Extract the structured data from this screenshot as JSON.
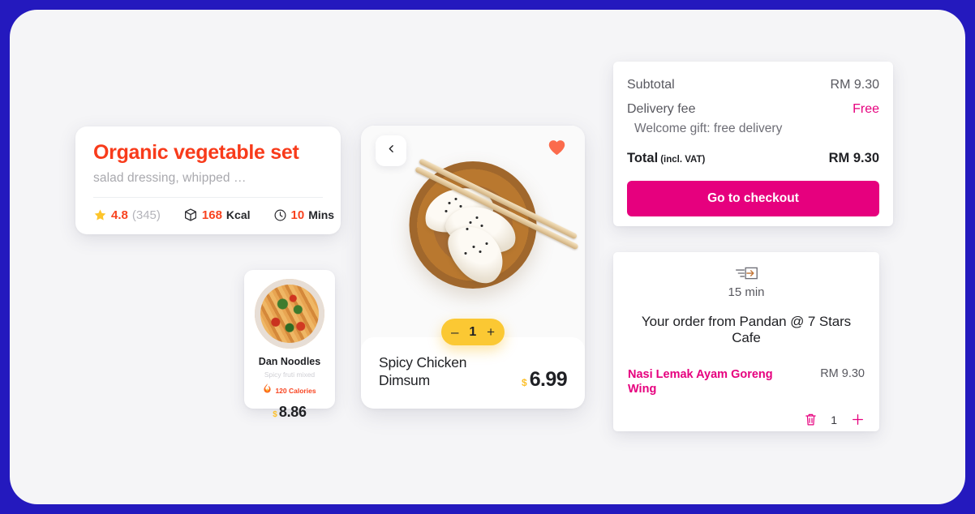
{
  "theme": {
    "frame_blue": "#2419be",
    "canvas_bg": "#f5f5f7",
    "accent_orange": "#f8431f",
    "accent_pink": "#e6007e",
    "accent_yellow": "#fbc833",
    "heart_coral": "#fb6b4c"
  },
  "organic_card": {
    "title": "Organic vegetable set",
    "subtitle": "salad dressing, whipped …",
    "stats": [
      {
        "icon": "star-icon",
        "value": "4.8",
        "suffix": "(345)",
        "unit": ""
      },
      {
        "icon": "box-icon",
        "value": "168",
        "unit": "Kcal",
        "suffix": ""
      },
      {
        "icon": "clock-icon",
        "value": "10",
        "unit": "Mins",
        "suffix": ""
      }
    ]
  },
  "dan_card": {
    "image_alt": "dan-noodles-photo",
    "name": "Dan Noodles",
    "description": "Spicy fruti mixed",
    "calories_icon": "flame-icon",
    "calories": "120 Calories",
    "currency": "$",
    "price": "8.86"
  },
  "dimsum_card": {
    "back_icon": "chevron-left-icon",
    "favorite_icon": "heart-icon",
    "image_alt": "spicy-chicken-dimsum-photo",
    "quantity": {
      "decrement_label": "–",
      "value": "1",
      "increment_label": "+"
    },
    "name": "Spicy Chicken Dimsum",
    "currency": "$",
    "price": "6.99"
  },
  "checkout": {
    "subtotal_label": "Subtotal",
    "subtotal_value": "RM 9.30",
    "delivery_label": "Delivery fee",
    "delivery_value": "Free",
    "welcome_gift": "Welcome gift: free delivery",
    "total_label": "Total",
    "total_vat_note": "(incl. VAT)",
    "total_value": "RM 9.30",
    "checkout_button": "Go to checkout"
  },
  "order": {
    "eta_icon": "delivery-truck-icon",
    "eta_time": "15 min",
    "heading": "Your order from Pandan @ 7 Stars Cafe",
    "item_name": "Nasi Lemak Ayam Goreng Wing",
    "item_price": "RM 9.30",
    "delete_icon": "trash-icon",
    "item_quantity": "1",
    "increment_icon": "plus-icon"
  }
}
